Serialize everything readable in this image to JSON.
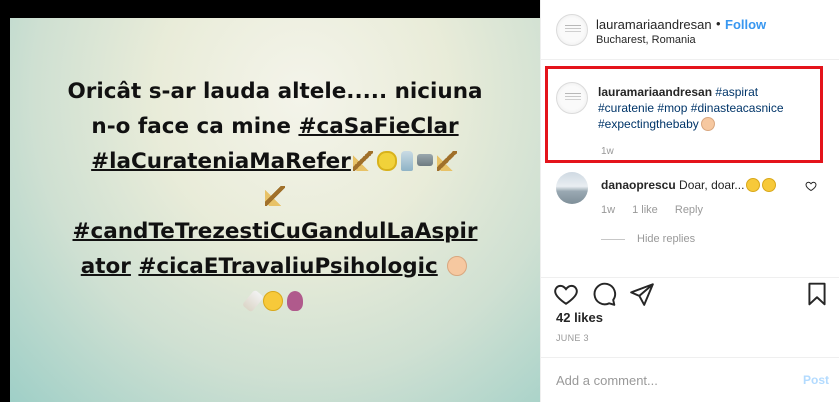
{
  "post": {
    "text": {
      "line1": "Oricât s-ar lauda altele..... niciuna",
      "line2a": "n-o face ca mine ",
      "tag1": "#caSaFieClar",
      "tag2": "#laCurateniaMaRefer",
      "tag3": "#candTeTrezestiCuGandulLaAspir",
      "tag3b": "ator",
      "tag4": "#cicaETravaliuPsihologic"
    },
    "emojis": [
      "broom-icon",
      "sponge-icon",
      "spray-icon",
      "tap-icon",
      "broom-icon",
      "baby-face-icon",
      "baby-bottle-icon",
      "silly-face-icon",
      "pregnant-woman-icon"
    ]
  },
  "header": {
    "username": "lauramariaandresan",
    "dot": "•",
    "follow_label": "Follow",
    "location": "Bucharest, Romania"
  },
  "caption": {
    "username": "lauramariaandresan",
    "tags": [
      "#aspirat",
      "#curatenie",
      "#mop",
      "#dinasteacasnice",
      "#expectingthebaby"
    ],
    "time": "1w"
  },
  "comment": {
    "username": "danaoprescu",
    "text": "Doar, doar...",
    "time": "1w",
    "likes": "1 like",
    "reply_label": "Reply",
    "hide_replies": "Hide replies"
  },
  "stats": {
    "likes": "42 likes",
    "date": "JUNE 3"
  },
  "comment_box": {
    "placeholder": "Add a comment...",
    "post_label": "Post"
  },
  "colors": {
    "accent": "#3897f0",
    "highlight_border": "#e4131b",
    "hashtag": "#003569"
  }
}
